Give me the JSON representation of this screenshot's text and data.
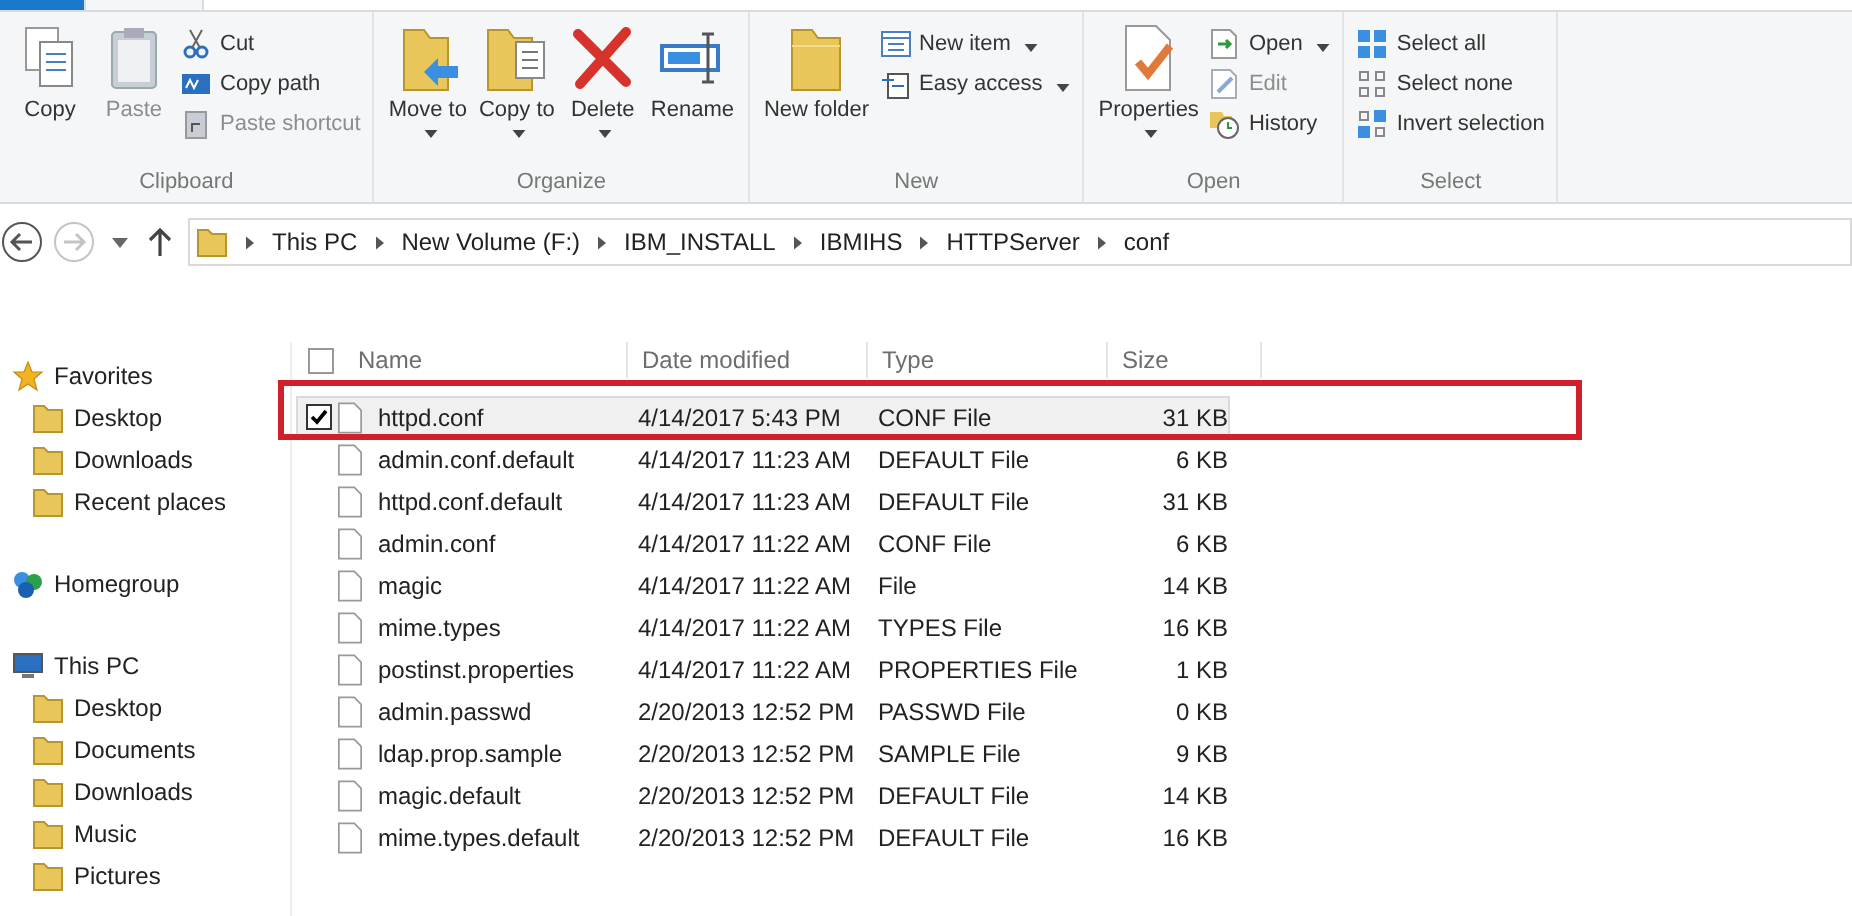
{
  "ribbon": {
    "groups": [
      {
        "label": "Clipboard",
        "large": [
          {
            "label": "Copy",
            "dropdown": false,
            "disabled": false
          },
          {
            "label": "Paste",
            "dropdown": false,
            "disabled": true
          }
        ],
        "small": [
          {
            "label": "Cut",
            "dropdown": false,
            "disabled": false
          },
          {
            "label": "Copy path",
            "dropdown": false,
            "disabled": false
          },
          {
            "label": "Paste shortcut",
            "dropdown": false,
            "disabled": true
          }
        ]
      },
      {
        "label": "Organize",
        "large": [
          {
            "label": "Move to",
            "dropdown": true,
            "disabled": false
          },
          {
            "label": "Copy to",
            "dropdown": true,
            "disabled": false
          },
          {
            "label": "Delete",
            "dropdown": true,
            "disabled": false
          },
          {
            "label": "Rename",
            "dropdown": false,
            "disabled": false
          }
        ]
      },
      {
        "label": "New",
        "large": [
          {
            "label": "New folder",
            "dropdown": false,
            "disabled": false
          }
        ],
        "small": [
          {
            "label": "New item",
            "dropdown": true,
            "disabled": false
          },
          {
            "label": "Easy access",
            "dropdown": true,
            "disabled": false
          }
        ]
      },
      {
        "label": "Open",
        "large": [
          {
            "label": "Properties",
            "dropdown": true,
            "disabled": false
          }
        ],
        "small": [
          {
            "label": "Open",
            "dropdown": true,
            "disabled": false
          },
          {
            "label": "Edit",
            "dropdown": false,
            "disabled": true
          },
          {
            "label": "History",
            "dropdown": false,
            "disabled": false
          }
        ]
      },
      {
        "label": "Select",
        "small": [
          {
            "label": "Select all",
            "dropdown": false,
            "disabled": false
          },
          {
            "label": "Select none",
            "dropdown": false,
            "disabled": false
          },
          {
            "label": "Invert selection",
            "dropdown": false,
            "disabled": false
          }
        ]
      }
    ]
  },
  "navigation": {
    "back_disabled": false,
    "forward_disabled": true
  },
  "address_bar": {
    "segments": [
      "This PC",
      "New Volume (F:)",
      "IBM_INSTALL",
      "IBMIHS",
      "HTTPServer",
      "conf"
    ]
  },
  "sidebar": {
    "sections": [
      {
        "label": "Favorites",
        "kind": "favorites",
        "children": [
          {
            "label": "Desktop"
          },
          {
            "label": "Downloads"
          },
          {
            "label": "Recent places"
          }
        ]
      },
      {
        "label": "Homegroup",
        "kind": "homegroup"
      },
      {
        "label": "This PC",
        "kind": "pc",
        "children": [
          {
            "label": "Desktop"
          },
          {
            "label": "Documents"
          },
          {
            "label": "Downloads"
          },
          {
            "label": "Music"
          },
          {
            "label": "Pictures"
          }
        ]
      }
    ]
  },
  "table": {
    "select_all_checked": false,
    "columns": [
      "Name",
      "Date modified",
      "Type",
      "Size"
    ],
    "rows": [
      {
        "name": "httpd.conf",
        "date": "4/14/2017 5:43 PM",
        "type": "CONF File",
        "size": "31 KB",
        "selected": true,
        "checked": true,
        "highlighted": true
      },
      {
        "name": "admin.conf.default",
        "date": "4/14/2017 11:23 AM",
        "type": "DEFAULT File",
        "size": "6 KB",
        "selected": false,
        "checked": false,
        "highlighted": false
      },
      {
        "name": "httpd.conf.default",
        "date": "4/14/2017 11:23 AM",
        "type": "DEFAULT File",
        "size": "31 KB",
        "selected": false,
        "checked": false,
        "highlighted": false
      },
      {
        "name": "admin.conf",
        "date": "4/14/2017 11:22 AM",
        "type": "CONF File",
        "size": "6 KB",
        "selected": false,
        "checked": false,
        "highlighted": false
      },
      {
        "name": "magic",
        "date": "4/14/2017 11:22 AM",
        "type": "File",
        "size": "14 KB",
        "selected": false,
        "checked": false,
        "highlighted": false
      },
      {
        "name": "mime.types",
        "date": "4/14/2017 11:22 AM",
        "type": "TYPES File",
        "size": "16 KB",
        "selected": false,
        "checked": false,
        "highlighted": false
      },
      {
        "name": "postinst.properties",
        "date": "4/14/2017 11:22 AM",
        "type": "PROPERTIES File",
        "size": "1 KB",
        "selected": false,
        "checked": false,
        "highlighted": false
      },
      {
        "name": "admin.passwd",
        "date": "2/20/2013 12:52 PM",
        "type": "PASSWD File",
        "size": "0 KB",
        "selected": false,
        "checked": false,
        "highlighted": false
      },
      {
        "name": "ldap.prop.sample",
        "date": "2/20/2013 12:52 PM",
        "type": "SAMPLE File",
        "size": "9 KB",
        "selected": false,
        "checked": false,
        "highlighted": false
      },
      {
        "name": "magic.default",
        "date": "2/20/2013 12:52 PM",
        "type": "DEFAULT File",
        "size": "14 KB",
        "selected": false,
        "checked": false,
        "highlighted": false
      },
      {
        "name": "mime.types.default",
        "date": "2/20/2013 12:52 PM",
        "type": "DEFAULT File",
        "size": "16 KB",
        "selected": false,
        "checked": false,
        "highlighted": false
      }
    ]
  }
}
